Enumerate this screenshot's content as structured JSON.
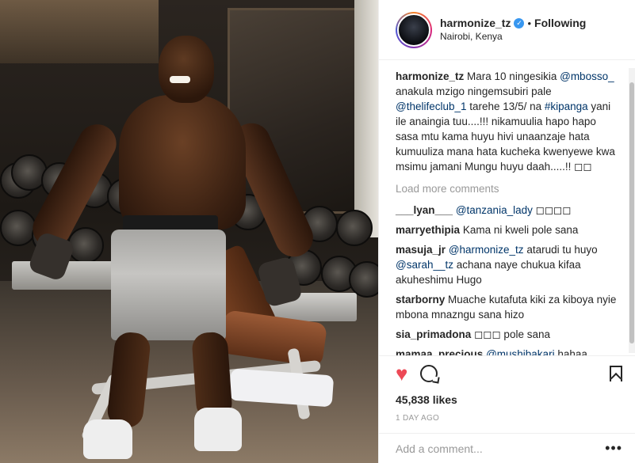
{
  "header": {
    "username": "harmonize_tz",
    "verified_glyph": "✓",
    "separator": "•",
    "follow_status": "Following",
    "location": "Nairobi, Kenya"
  },
  "caption": {
    "username": "harmonize_tz",
    "t1": " Mara 10 ningesikia ",
    "m1": "@mbosso_",
    "t2": " anakula mzigo ningemsubiri pale ",
    "m2": "@thelifeclub_1",
    "t3": " tarehe 13/5/ na ",
    "hashtag": "#kipanga",
    "t4": " yani ile anaingia tuu....!!! nikamuulia hapo hapo sasa mtu kama huyu hivi unaanzaje hata kumuuliza mana hata kucheka kwenyewe kwa msimu jamani Mungu huyu daah.....!! ◻◻"
  },
  "load_more": "Load more comments",
  "comments": [
    {
      "user": "___lyan___",
      "mention": "@tanzania_lady",
      "text": " ◻◻◻◻"
    },
    {
      "user": "marryethipia",
      "mention": "",
      "text": "Kama ni kweli pole sana"
    },
    {
      "user": "masuja_jr",
      "mention": "@harmonize_tz",
      "text": " atarudi tu huyo ",
      "mention2": "@sarah__tz",
      "text2": " achana naye chukua kifaa akuheshimu Hugo"
    },
    {
      "user": "starborny",
      "mention": "",
      "text": "Muache kutafuta kiki za kiboya nyie mbona mnazngu sana hizo"
    },
    {
      "user": "sia_primadona",
      "mention": "",
      "text": "◻◻◻ pole sana"
    },
    {
      "user": "mamaa_precious",
      "mention": "@mushibakari",
      "text": " hahaa"
    }
  ],
  "actions": {
    "liked": true,
    "heart_glyph": "♥"
  },
  "likes": "45,838 likes",
  "timestamp": "1 DAY AGO",
  "add_comment": {
    "placeholder": "Add a comment...",
    "more_glyph": "•••"
  },
  "colors": {
    "accent_blue": "#3897f0",
    "link": "#003569",
    "heart": "#ed4956"
  }
}
